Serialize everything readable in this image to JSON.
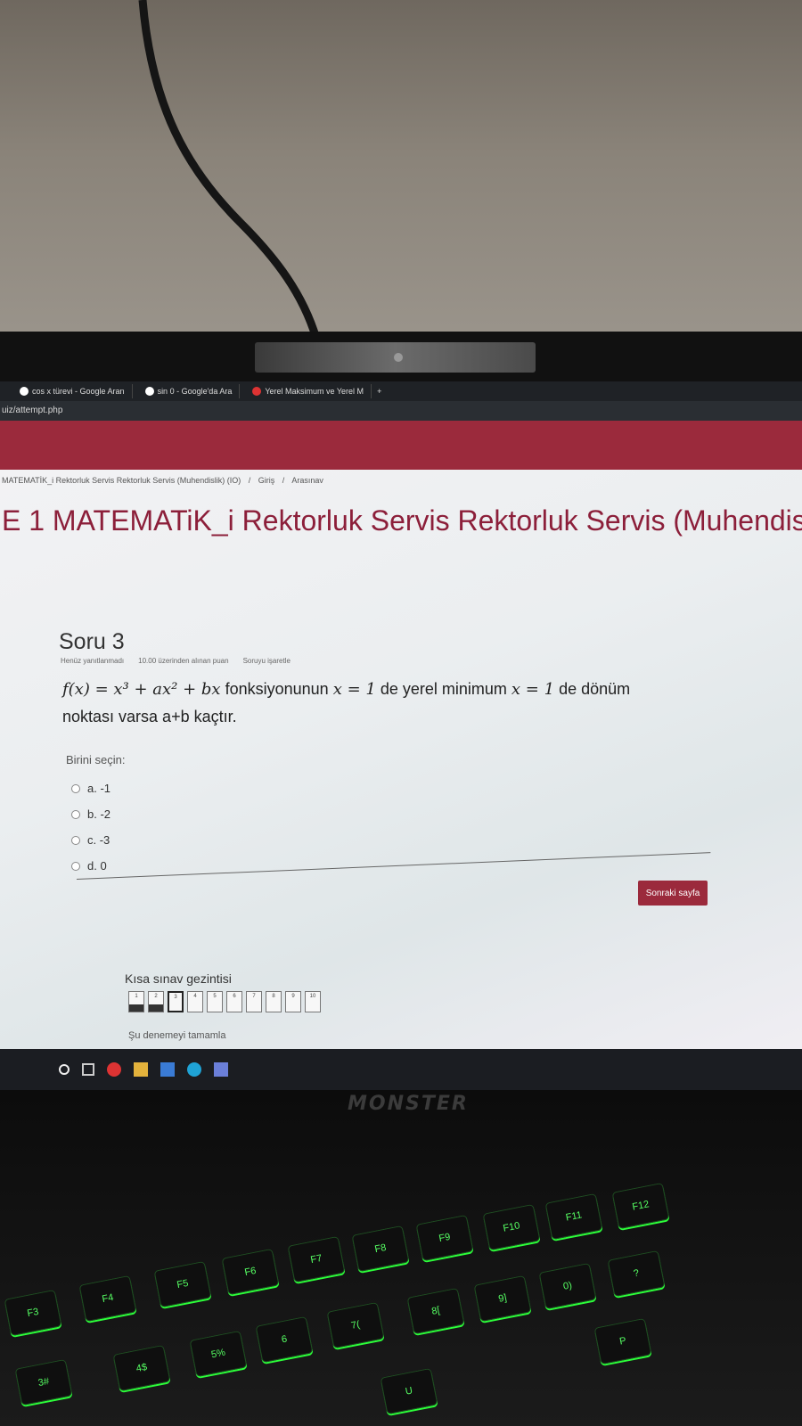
{
  "browser": {
    "tabs": [
      {
        "label": "cos x türevi - Google Aran"
      },
      {
        "label": "sin 0 - Google'da Ara"
      },
      {
        "label": "Yerel Maksimum ve Yerel M"
      }
    ],
    "new_tab": "+",
    "url": "uiz/attempt.php"
  },
  "breadcrumb": [
    "MATEMATİK_i Rektorluk Servis Rektorluk Servis (Muhendislik) (IO)",
    "/",
    "Giriş",
    "/",
    "Arasınav"
  ],
  "page_title": "E 1 MATEMATiK_i Rektorluk Servis Rektorluk Servis (Muhendis",
  "question": {
    "number_label": "Soru 3",
    "status": "Henüz yanıtlanmadı",
    "points": "10.00 üzerinden alınan puan",
    "flag": "Soruyu işaretle",
    "text_math": "f(x) = x³ + ax² + bx",
    "text_part1": "fonksiyonunun",
    "text_math2": "x = 1",
    "text_part2": "de yerel minimum",
    "text_math3": "x = 1",
    "text_part3": "de dönüm noktası varsa a+b kaçtır.",
    "prompt": "Birini seçin:",
    "options": [
      "a. -1",
      "b. -2",
      "c. -3",
      "d. 0"
    ]
  },
  "next_button": "Sonraki sayfa",
  "quiz_nav": {
    "title": "Kısa sınav gezintisi",
    "boxes": [
      "1",
      "2",
      "3",
      "4",
      "5",
      "6",
      "7",
      "8",
      "9",
      "10"
    ],
    "finish_link": "Şu denemeyi tamamla"
  },
  "laptop_brand": "MONSTER",
  "keyboard": [
    "F3",
    "F4",
    "F5",
    "F6",
    "F7",
    "F8",
    "F9",
    "F10",
    "F11",
    "F12",
    "3#",
    "4$",
    "5%",
    "6",
    "7(",
    "8[",
    "9]",
    "0)",
    "?",
    "P",
    "U"
  ]
}
